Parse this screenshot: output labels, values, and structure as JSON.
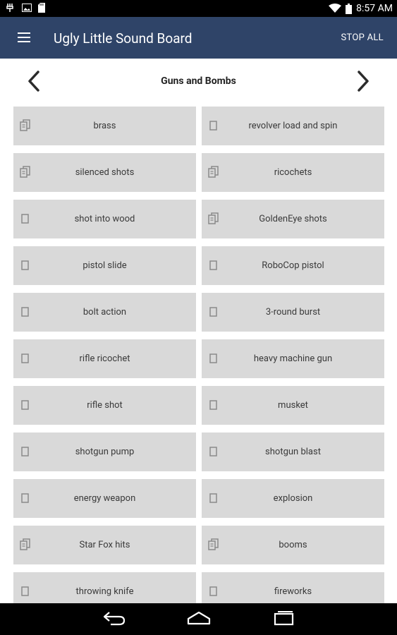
{
  "status_bar": {
    "time": "8:57 AM",
    "left_icons": [
      "usb-debug-icon",
      "image-icon",
      "sd-card-icon"
    ],
    "right_icons": [
      "wifi-icon",
      "battery-icon"
    ]
  },
  "app_bar": {
    "title": "Ugly Little Sound Board",
    "action": "STOP ALL"
  },
  "category": {
    "title": "Guns and Bombs"
  },
  "sounds": [
    {
      "label": "brass",
      "icon": "multi"
    },
    {
      "label": "revolver load and spin",
      "icon": "single"
    },
    {
      "label": "silenced shots",
      "icon": "multi"
    },
    {
      "label": "ricochets",
      "icon": "multi"
    },
    {
      "label": "shot into wood",
      "icon": "single"
    },
    {
      "label": "GoldenEye shots",
      "icon": "multi"
    },
    {
      "label": "pistol slide",
      "icon": "single"
    },
    {
      "label": "RoboCop pistol",
      "icon": "single"
    },
    {
      "label": "bolt action",
      "icon": "single"
    },
    {
      "label": "3-round burst",
      "icon": "single"
    },
    {
      "label": "rifle ricochet",
      "icon": "single"
    },
    {
      "label": "heavy machine gun",
      "icon": "single"
    },
    {
      "label": "rifle shot",
      "icon": "single"
    },
    {
      "label": "musket",
      "icon": "single"
    },
    {
      "label": "shotgun pump",
      "icon": "single"
    },
    {
      "label": "shotgun blast",
      "icon": "single"
    },
    {
      "label": "energy weapon",
      "icon": "single"
    },
    {
      "label": "explosion",
      "icon": "single"
    },
    {
      "label": "Star Fox hits",
      "icon": "multi"
    },
    {
      "label": "booms",
      "icon": "multi"
    },
    {
      "label": "throwing knife",
      "icon": "single"
    },
    {
      "label": "fireworks",
      "icon": "single"
    }
  ],
  "nav_bar": {
    "buttons": [
      "back-icon",
      "home-icon",
      "recents-icon"
    ]
  },
  "colors": {
    "app_bar": "#2f4468",
    "tile": "#d9d9d9",
    "tile_text": "#3a3a3a",
    "icon": "#8a8a8a"
  }
}
